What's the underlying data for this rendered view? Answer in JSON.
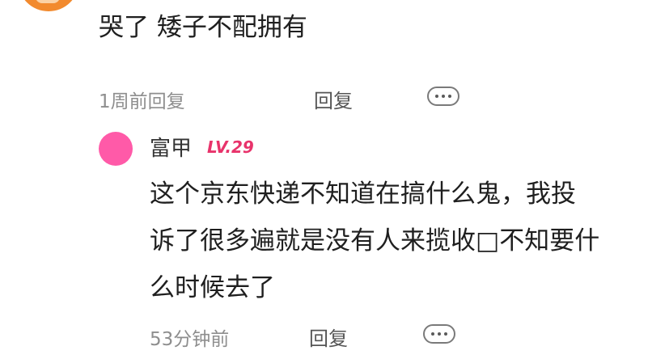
{
  "parent_comment": {
    "text": "哭了 矮子不配拥有",
    "time": "1周前",
    "reply_inline": "回复",
    "reply_label": "回复"
  },
  "reply_comment": {
    "username": "富甲",
    "level": "LV.29",
    "text_lines": [
      "这个京东快递不知道在搞什么鬼，我投",
      "诉了很多遍就是没有人来揽收□不知要什",
      "么时候去了"
    ],
    "time": "53分钟前",
    "reply_label": "回复"
  },
  "icons": {
    "more": "more-dots-icon",
    "avatar_color_reply": "#ff5aa8",
    "avatar_color_parent": "#f28a2e",
    "level_color": "#e8336b"
  }
}
